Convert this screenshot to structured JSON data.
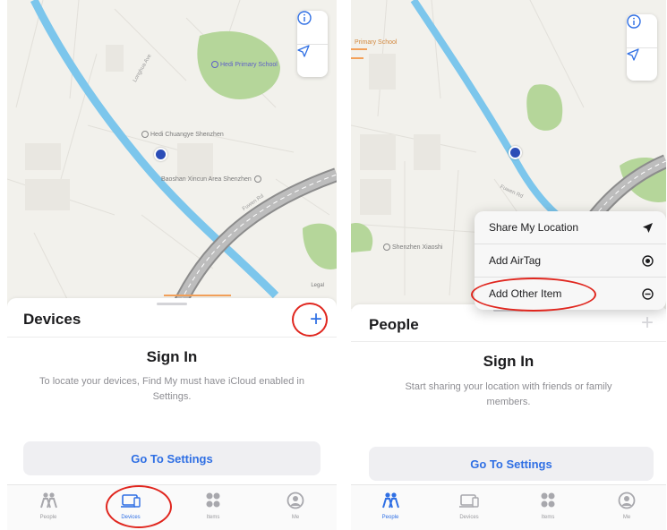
{
  "left": {
    "map_pois": [
      "Hedi Chuangye Shenzhen",
      "Baoshan Xincun Area Shenzhen",
      "Hedi Primary School"
    ],
    "map_streets": [
      "Longhua Ave",
      "Fuwen Rd"
    ],
    "map_legal": "Legal",
    "sheet_title": "Devices",
    "signin_title": "Sign In",
    "signin_desc": "To locate your devices, Find My must have iCloud enabled in Settings.",
    "settings_button": "Go To Settings",
    "tabs": [
      {
        "label": "People",
        "icon": "people-icon"
      },
      {
        "label": "Devices",
        "icon": "devices-icon"
      },
      {
        "label": "Items",
        "icon": "items-icon"
      },
      {
        "label": "Me",
        "icon": "me-icon"
      }
    ],
    "active_tab": "Devices"
  },
  "right": {
    "map_pois": [
      "Primary School",
      "Shenzhen Xiaoshi"
    ],
    "map_streets": [
      "Fuwen Rd"
    ],
    "menu_items": [
      {
        "label": "Share My Location",
        "icon": "location-arrow-icon"
      },
      {
        "label": "Add AirTag",
        "icon": "airtag-icon"
      },
      {
        "label": "Add Other Item",
        "icon": "other-item-icon"
      }
    ],
    "sheet_title": "People",
    "signin_title": "Sign In",
    "signin_desc": "Start sharing your location with friends or family members.",
    "settings_button": "Go To Settings",
    "tabs": [
      {
        "label": "People",
        "icon": "people-icon"
      },
      {
        "label": "Devices",
        "icon": "devices-icon"
      },
      {
        "label": "Items",
        "icon": "items-icon"
      },
      {
        "label": "Me",
        "icon": "me-icon"
      }
    ],
    "active_tab": "People"
  },
  "colors": {
    "accent": "#2f6fe4",
    "annotation": "#e0261e",
    "map_bg": "#f2f1ec",
    "park": "#b5d69a",
    "river": "#7cc6ec"
  }
}
